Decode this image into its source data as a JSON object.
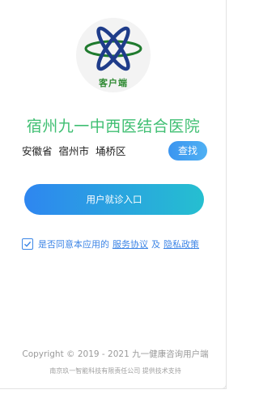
{
  "logo": {
    "text": "客户端",
    "icon": "atom-cross-logo-icon",
    "colors": {
      "ring": "#1f7a2e",
      "cross": "#1f3c8a",
      "text": "#2f8a33"
    }
  },
  "hospital": {
    "name": "宿州九一中西医结合医院"
  },
  "location": {
    "province": "安徽省",
    "city": "宿州市",
    "district": "埇桥区"
  },
  "buttons": {
    "find": "查找",
    "entry": "用户就诊入口"
  },
  "agreement": {
    "checked": true,
    "prefix": "是否同意本应用的",
    "service": "服务协议",
    "and": "及",
    "privacy": "隐私政策"
  },
  "footer": {
    "copyright": "Copyright © 2019 - 2021 九一健康咨询用户端",
    "support": "南京玖一智能科技有限责任公司 提供技术支持"
  },
  "theme": {
    "accent_green": "#3fbf72",
    "accent_blue": "#3b95f0",
    "link_blue": "#3f86e6"
  }
}
